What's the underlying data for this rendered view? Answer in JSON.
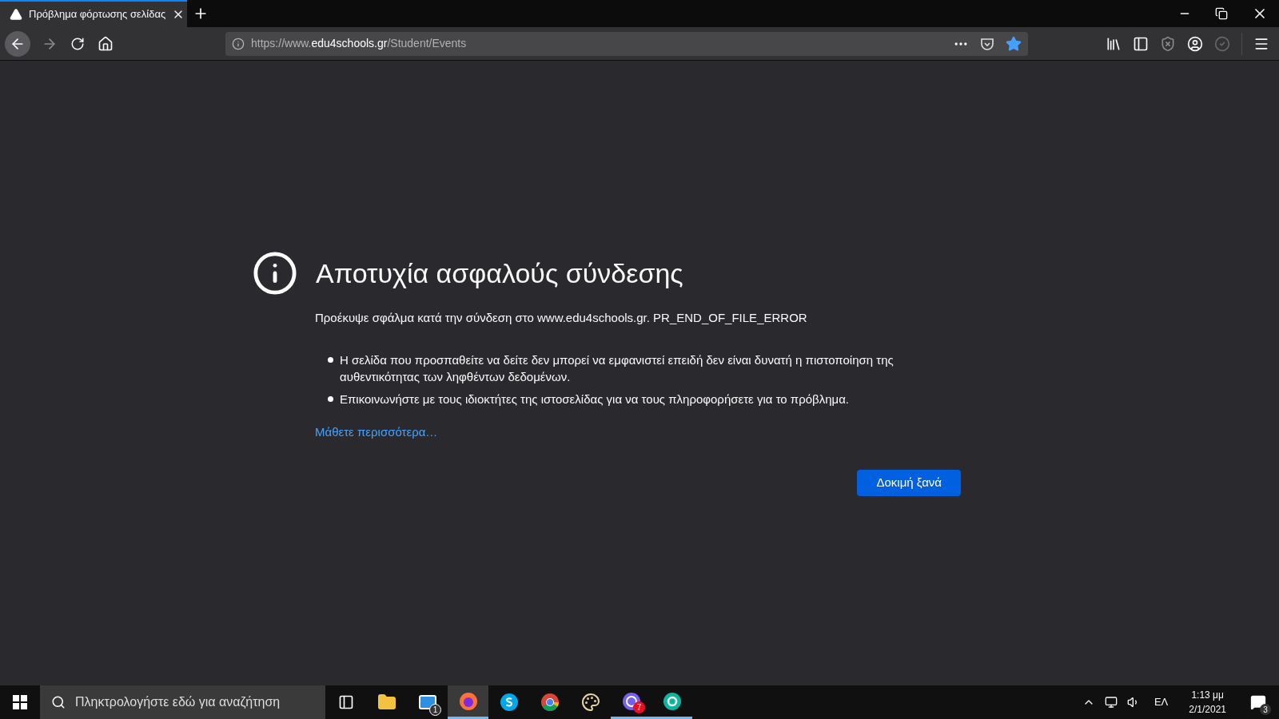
{
  "tab": {
    "title": "Πρόβλημα φόρτωσης σελίδας",
    "selected": true
  },
  "url": {
    "prefix": "https://www.",
    "domain": "edu4schools.gr",
    "path": "/Student/Events"
  },
  "bookmarked": true,
  "error": {
    "title": "Αποτυχία ασφαλούς σύνδεσης",
    "message": "Προέκυψε σφάλμα κατά την σύνδεση στο www.edu4schools.gr. PR_END_OF_FILE_ERROR",
    "bullets": [
      "Η σελίδα που προσπαθείτε να δείτε δεν μπορεί να εμφανιστεί επειδή δεν είναι δυνατή η πιστοποίηση της αυθεντικότητας των ληφθέντων δεδομένων.",
      "Επικοινωνήστε με τους ιδιοκτήτες της ιστοσελίδας για να τους πληροφορήσετε για το πρόβλημα."
    ],
    "link": "Μάθετε περισσότερα…",
    "button": "Δοκιμή ξανά"
  },
  "taskbar": {
    "search": {
      "placeholder": "Πληκτρολογήστε εδώ για αναζήτηση"
    },
    "apps": [
      {
        "kind": "taskview",
        "running": false,
        "selected": false
      },
      {
        "kind": "files",
        "running": false,
        "selected": false
      },
      {
        "kind": "mail",
        "running": false,
        "selected": false,
        "badge": "1"
      },
      {
        "kind": "firefox",
        "running": true,
        "selected": true
      },
      {
        "kind": "skype",
        "running": false,
        "selected": false
      },
      {
        "kind": "chrome",
        "running": false,
        "selected": false
      },
      {
        "kind": "paint",
        "running": false,
        "selected": false
      },
      {
        "kind": "viber",
        "running": true,
        "selected": false,
        "badge": "7"
      },
      {
        "kind": "eset",
        "running": true,
        "selected": false
      }
    ],
    "language": "ΕΛ",
    "time": "1:13 μμ",
    "date": "2/1/2021",
    "notifications": "3"
  }
}
